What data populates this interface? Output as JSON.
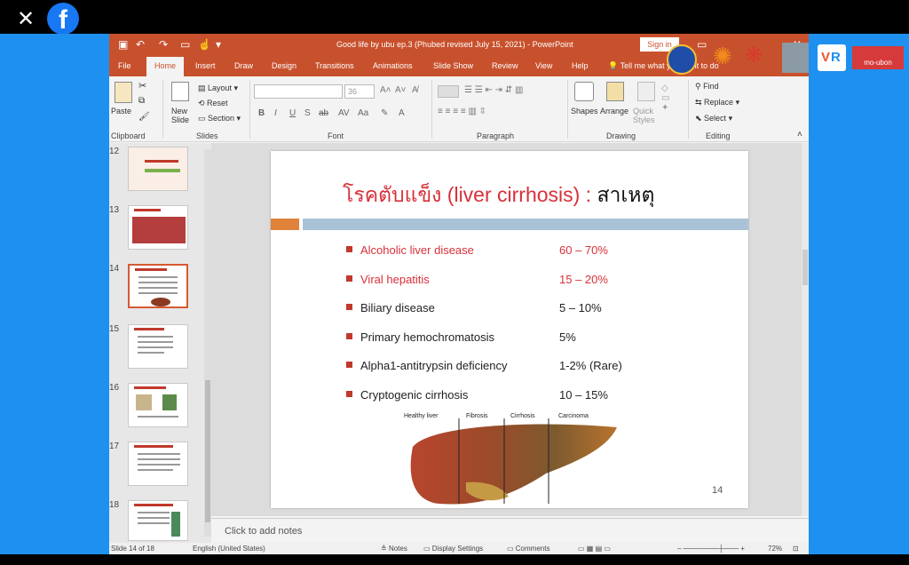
{
  "window": {
    "close_glyph": "✕",
    "fb_glyph": "f",
    "doc_title": "Good life by ubu ep.3 (Phubed revised July 15, 2021)  -  PowerPoint",
    "signin": "Sign in"
  },
  "tabs": [
    "File",
    "Home",
    "Insert",
    "Draw",
    "Design",
    "Transitions",
    "Animations",
    "Slide Show",
    "Review",
    "View",
    "Help",
    "Tell me what you want to do"
  ],
  "ribbon": {
    "paste": "Paste",
    "clipboard": "Clipboard",
    "new_slide": "New Slide",
    "layout": "Layout",
    "reset": "Reset",
    "section": "Section",
    "slides": "Slides",
    "font_size": "36",
    "font": "Font",
    "paragraph": "Paragraph",
    "shapes": "Shapes",
    "arrange": "Arrange",
    "quick_styles": "Quick Styles",
    "drawing": "Drawing",
    "find": "Find",
    "replace": "Replace",
    "select": "Select",
    "editing": "Editing",
    "overlay_text": "mo-ubon"
  },
  "thumbnails": [
    {
      "num": "12"
    },
    {
      "num": "13"
    },
    {
      "num": "14"
    },
    {
      "num": "15"
    },
    {
      "num": "16"
    },
    {
      "num": "17"
    },
    {
      "num": "18"
    }
  ],
  "slide": {
    "title_red": "โรคตับแข็ง (liver cirrhosis) :",
    "title_black": " สาเหตุ",
    "rows": [
      {
        "label": "Alcoholic liver disease",
        "value": "60 – 70%"
      },
      {
        "label": "Viral hepatitis",
        "value": "15 – 20%"
      },
      {
        "label": "Biliary disease",
        "value": "5 – 10%"
      },
      {
        "label": "Primary hemochromatosis",
        "value": "5%"
      },
      {
        "label": "Alpha1-antitrypsin deficiency",
        "value": "1-2% (Rare)"
      },
      {
        "label": "Cryptogenic cirrhosis",
        "value": "10 – 15%"
      }
    ],
    "liver_labels": [
      "Healthy liver",
      "Fibrosis",
      "Cirrhosis",
      "Carcinoma"
    ],
    "page_number": "14"
  },
  "notes_placeholder": "Click to add notes",
  "status": {
    "slide_of": "Slide 14 of 18",
    "language": "English (United States)",
    "notes": "Notes",
    "display": "Display Settings",
    "comments": "Comments",
    "zoom": "72%"
  },
  "colors": {
    "accent": "#c8512d",
    "title_red": "#d8303a",
    "bar_blue": "#a9c2d8",
    "bar_orange": "#e0823a"
  }
}
